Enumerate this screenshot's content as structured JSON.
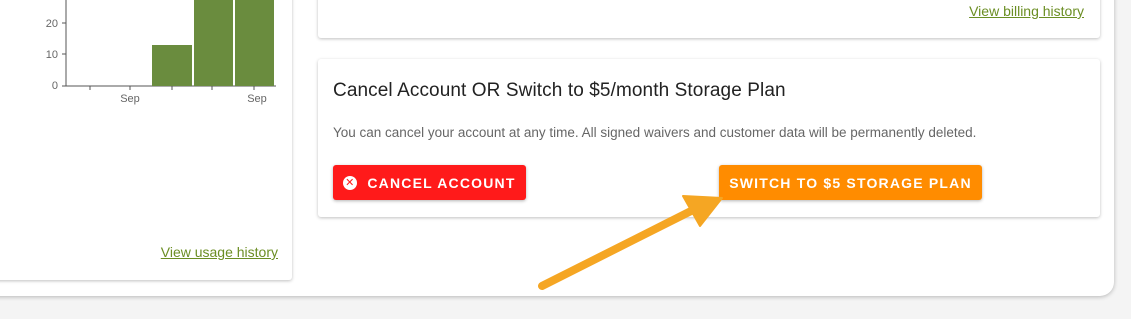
{
  "usage_panel": {
    "link": "View usage history",
    "chart_data": {
      "type": "bar",
      "categories": [
        "Sep",
        "",
        "",
        "",
        "Sep"
      ],
      "values": [
        0,
        13,
        28,
        28,
        0
      ],
      "y_ticks": [
        "20",
        "10",
        "0"
      ],
      "x_ticks": [
        "Sep",
        "Sep"
      ],
      "bar_color": "#6a8c3e"
    }
  },
  "billing_panel": {
    "link": "View billing history"
  },
  "cancel_panel": {
    "title": "Cancel Account OR Switch to $5/month Storage Plan",
    "description": "You can cancel your account at any time. All signed waivers and customer data will be permanently deleted.",
    "cancel_button": "CANCEL ACCOUNT",
    "switch_button": "SWITCH TO $5 STORAGE PLAN",
    "cancel_color": "#ff1a1a",
    "switch_color": "#ff8c00"
  },
  "annotation": {
    "arrow_color": "#f5a623"
  }
}
